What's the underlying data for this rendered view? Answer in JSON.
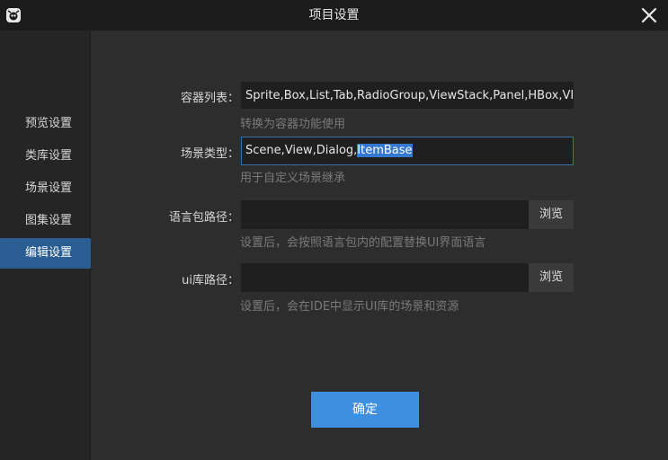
{
  "window": {
    "title": "项目设置",
    "logo_icon": "laya-logo-icon",
    "close_icon": "close-icon"
  },
  "sidebar": {
    "items": [
      {
        "label": "预览设置",
        "active": false
      },
      {
        "label": "类库设置",
        "active": false
      },
      {
        "label": "场景设置",
        "active": false
      },
      {
        "label": "图集设置",
        "active": false
      },
      {
        "label": "编辑设置",
        "active": true
      }
    ]
  },
  "form": {
    "containers": {
      "label": "容器列表：",
      "value": "Sprite,Box,List,Tab,RadioGroup,ViewStack,Panel,HBox,VI",
      "hint": "转换为容器功能使用"
    },
    "scene_types": {
      "label": "场景类型：",
      "value_plain": "Scene,View,Dialog,",
      "value_selected": "ItemBase",
      "hint": "用于自定义场景继承"
    },
    "lang_path": {
      "label": "语言包路径：",
      "value": "",
      "browse_label": "浏览",
      "hint": "设置后，会按照语言包内的配置替换UI界面语言"
    },
    "ui_lib_path": {
      "label": "ui库路径：",
      "value": "",
      "browse_label": "浏览",
      "hint": "设置后，会在IDE中显示UI库的场景和资源"
    }
  },
  "actions": {
    "ok_label": "确定"
  },
  "colors": {
    "accent": "#3f8fe0",
    "active_nav": "#2a5d91",
    "selection": "#3478d1"
  }
}
